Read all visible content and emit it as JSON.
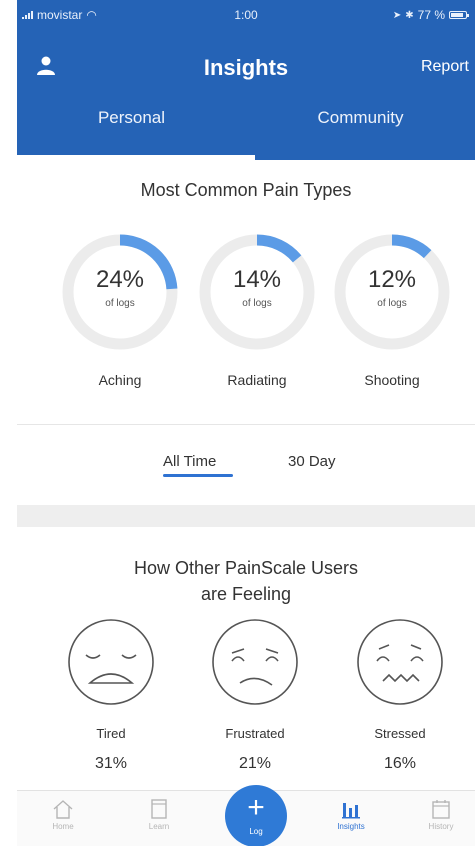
{
  "status_bar": {
    "carrier": "movistar",
    "time": "1:00",
    "battery": "77 %"
  },
  "nav": {
    "title": "Insights",
    "report_label": "Report"
  },
  "tabs": [
    {
      "label": "Personal"
    },
    {
      "label": "Community",
      "selected": true
    }
  ],
  "pain_types": {
    "title": "Most Common Pain Types",
    "sub_label": "of logs",
    "items": [
      {
        "percent_text": "24%",
        "value": 24,
        "name": "Aching"
      },
      {
        "percent_text": "14%",
        "value": 14,
        "name": "Radiating"
      },
      {
        "percent_text": "12%",
        "value": 12,
        "name": "Shooting"
      }
    ]
  },
  "periods": [
    {
      "label": "All Time",
      "selected": true
    },
    {
      "label": "30 Day",
      "selected": false
    }
  ],
  "feelings": {
    "title_line1": "How Other PainScale Users",
    "title_line2": "are Feeling",
    "items": [
      {
        "name": "Tired",
        "percent": "31%",
        "icon": "tired-face-icon"
      },
      {
        "name": "Frustrated",
        "percent": "21%",
        "icon": "frustrated-face-icon"
      },
      {
        "name": "Stressed",
        "percent": "16%",
        "icon": "stressed-face-icon"
      }
    ]
  },
  "tabbar": {
    "items": [
      {
        "label": "Home",
        "icon": "home-icon"
      },
      {
        "label": "Learn",
        "icon": "book-icon"
      },
      {
        "label": "Log",
        "icon": "plus-icon"
      },
      {
        "label": "Insights",
        "icon": "bar-chart-icon",
        "active": true
      },
      {
        "label": "History",
        "icon": "calendar-icon"
      }
    ]
  },
  "colors": {
    "primary": "#2563b6",
    "accent": "#5b9be6",
    "ring_track": "#ececec",
    "log_button": "#2f7ad6"
  }
}
